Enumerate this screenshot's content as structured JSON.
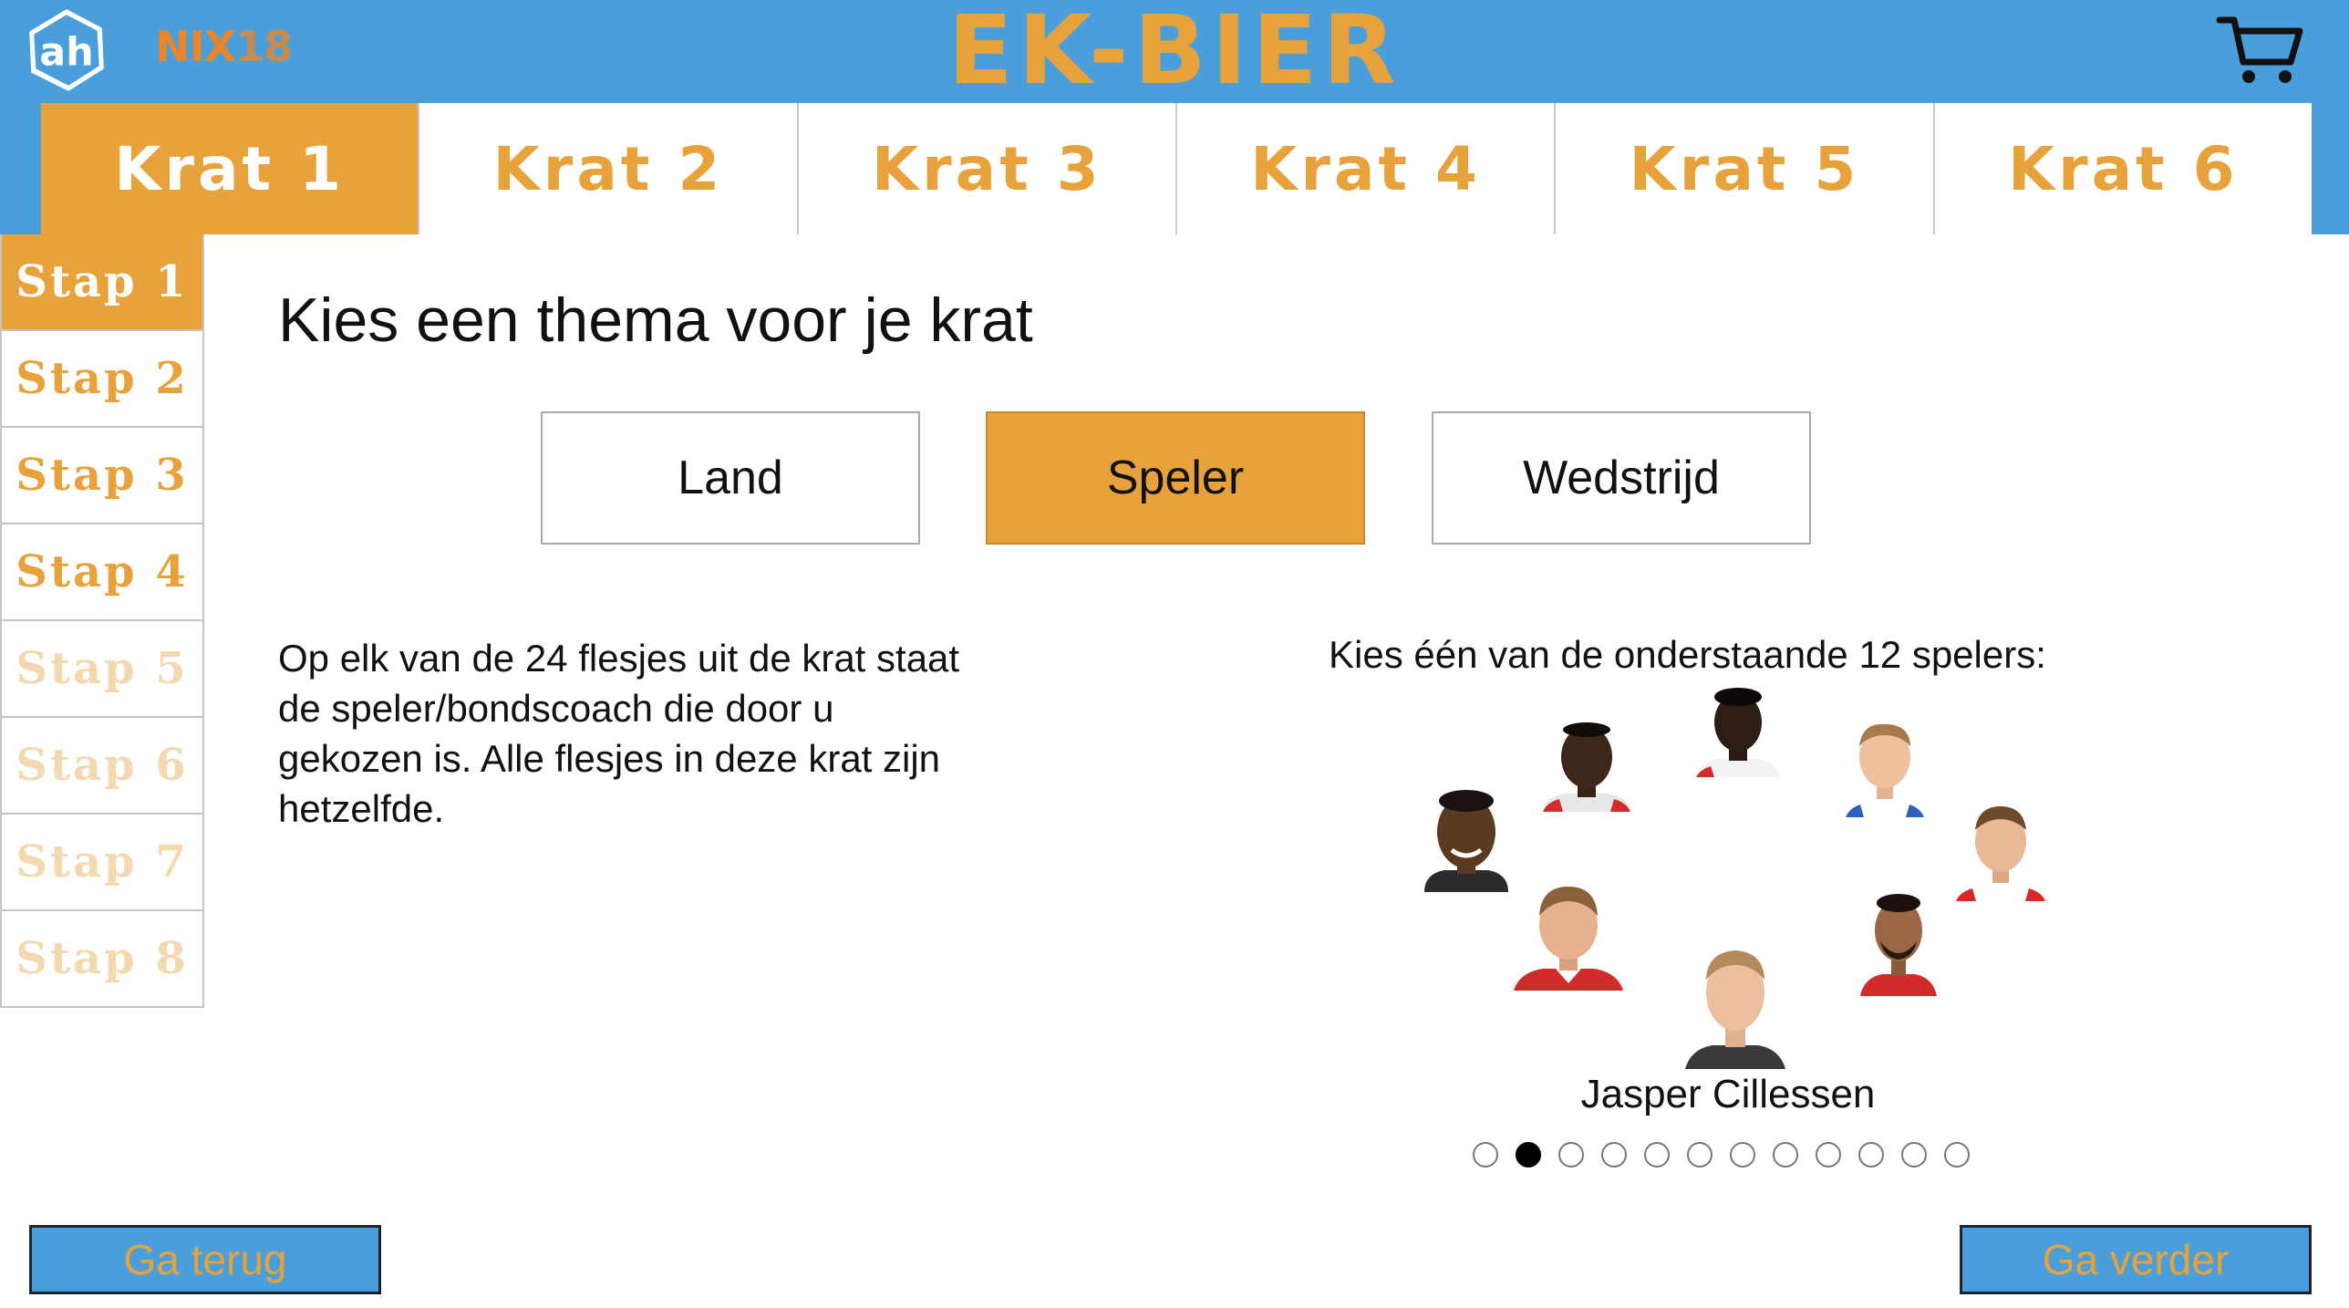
{
  "header": {
    "logo_text": "ah",
    "nix_left": "NIX",
    "nix_right": "18",
    "brand": "EK-BIER",
    "cart_icon": "cart-icon"
  },
  "tabs": [
    {
      "label": "Krat 1",
      "active": true
    },
    {
      "label": "Krat 2",
      "active": false
    },
    {
      "label": "Krat 3",
      "active": false
    },
    {
      "label": "Krat 4",
      "active": false
    },
    {
      "label": "Krat 5",
      "active": false
    },
    {
      "label": "Krat 6",
      "active": false
    }
  ],
  "steps": [
    {
      "label": "Stap 1",
      "state": "active"
    },
    {
      "label": "Stap 2",
      "state": "enabled"
    },
    {
      "label": "Stap 3",
      "state": "enabled"
    },
    {
      "label": "Stap 4",
      "state": "enabled"
    },
    {
      "label": "Stap 5",
      "state": "disabled"
    },
    {
      "label": "Stap 6",
      "state": "disabled"
    },
    {
      "label": "Stap 7",
      "state": "disabled"
    },
    {
      "label": "Stap 8",
      "state": "disabled"
    }
  ],
  "main": {
    "title": "Kies een thema voor je krat",
    "themes": [
      {
        "label": "Land",
        "active": false
      },
      {
        "label": "Speler",
        "active": true
      },
      {
        "label": "Wedstrijd",
        "active": false
      }
    ],
    "description": "Op elk van de 24 flesjes uit de krat staat de speler/bondscoach die door u gekozen is. Alle flesjes in deze krat zijn hetzelfde.",
    "pick_label": "Kies één van de onderstaande 12 spelers:",
    "selected_player": "Jasper Cillessen",
    "carousel": {
      "count": 12,
      "active_index": 1
    }
  },
  "footer": {
    "back_label": "Ga terug",
    "next_label": "Ga verder"
  },
  "colors": {
    "header_blue": "#4a9fdb",
    "accent_orange": "#e8a23c",
    "disabled_step": "#f2d9b0"
  }
}
